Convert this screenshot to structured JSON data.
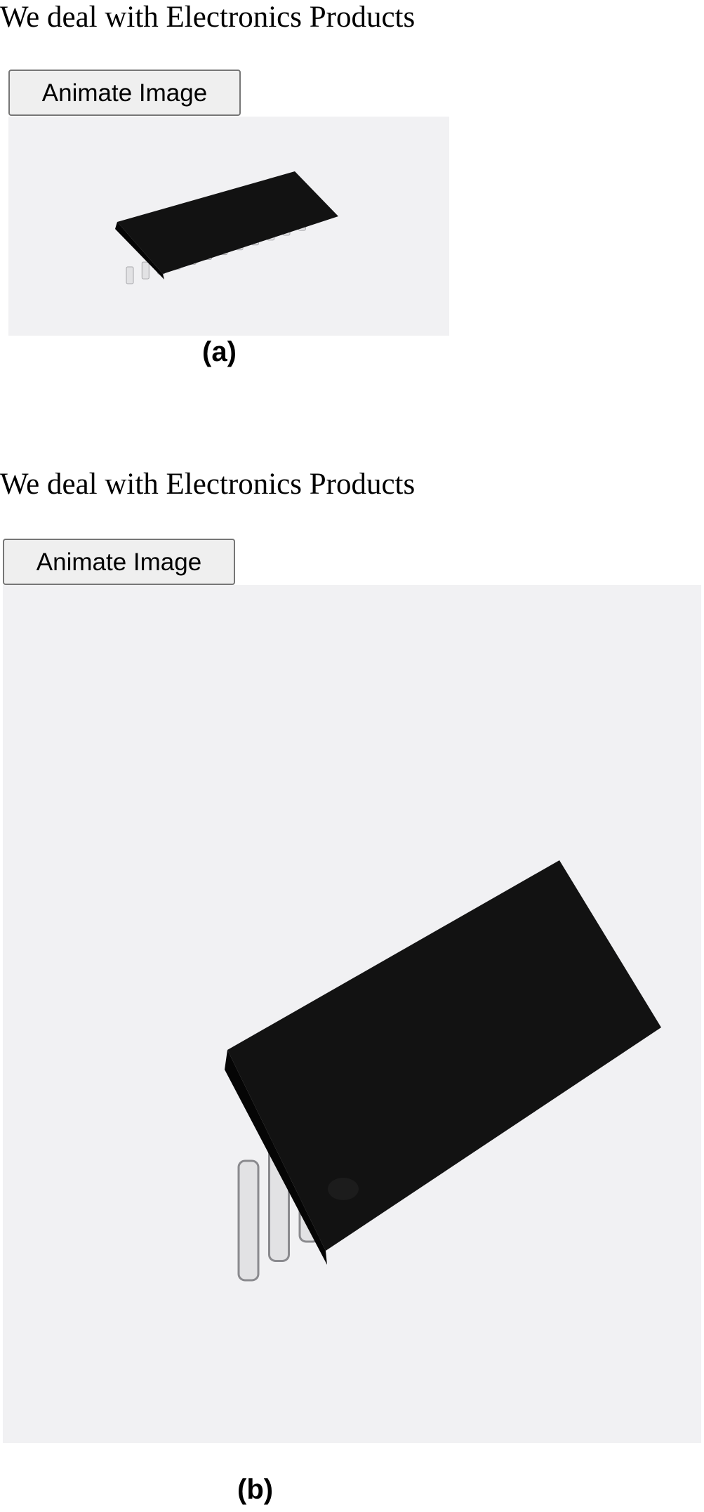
{
  "panel_a": {
    "heading": "We deal with Electronics Products",
    "button_label": "Animate Image",
    "image_icon": "ic-chip-icon",
    "caption": "(a)"
  },
  "panel_b": {
    "heading": "We deal with Electronics Products",
    "button_label": "Animate Image",
    "image_icon": "ic-chip-icon",
    "caption": "(b)"
  },
  "colors": {
    "image_background": "#f1f1f3",
    "chip_body": "#121212",
    "pin": "#e2e2e4",
    "button_background": "#efefef",
    "button_border": "#767676"
  }
}
